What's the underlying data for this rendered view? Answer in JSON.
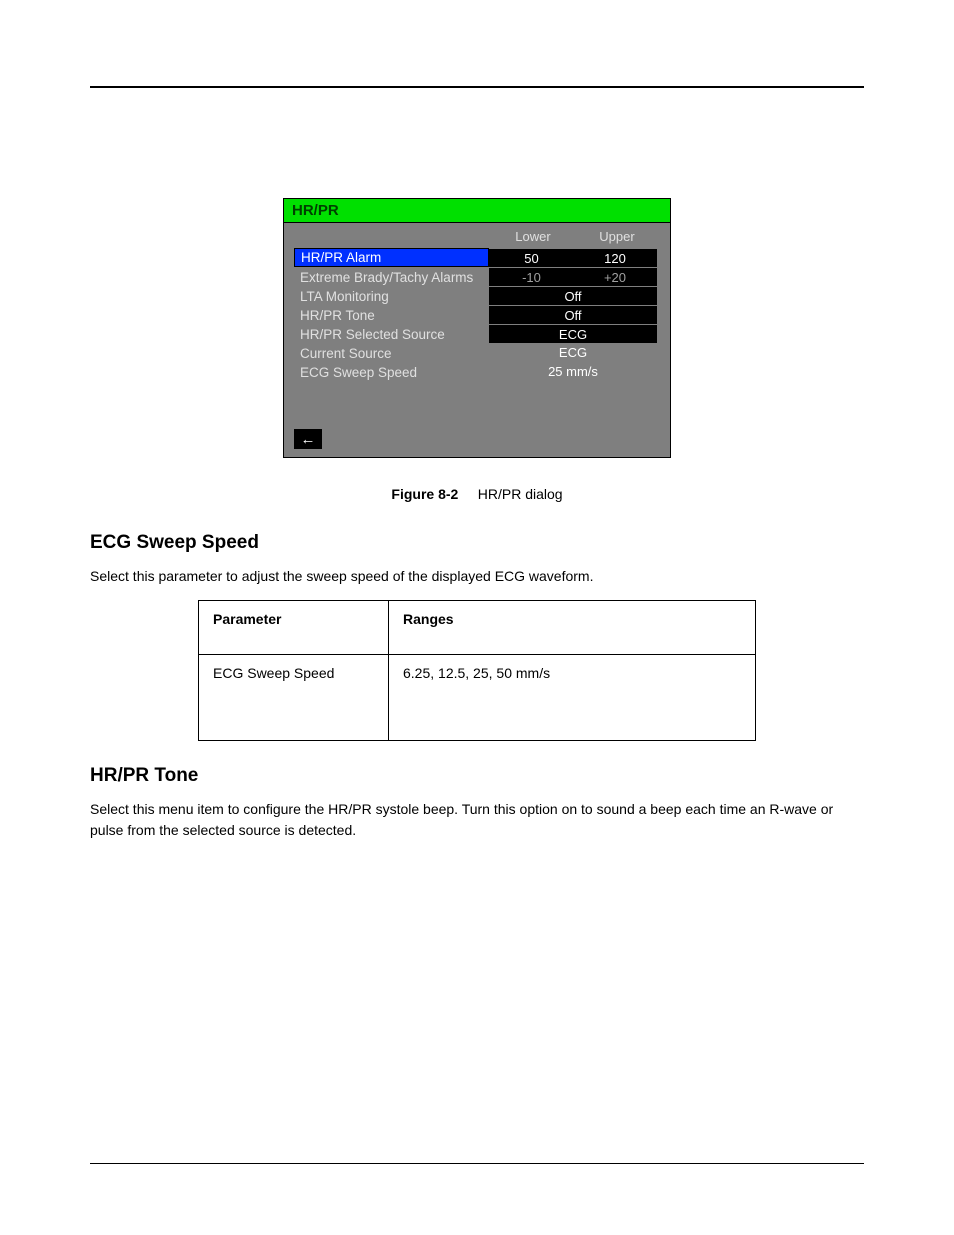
{
  "header": {
    "left": "",
    "right": ""
  },
  "dialog": {
    "title": "HR/PR",
    "col_lower": "Lower",
    "col_upper": "Upper",
    "rows": [
      {
        "label": "HR/PR Alarm",
        "selected": true,
        "lower": "50",
        "upper": "120",
        "split": true
      },
      {
        "label": "Extreme Brady/Tachy Alarms",
        "lower": "-10",
        "upper": "+20",
        "split": true,
        "dimval": true
      },
      {
        "label": "LTA Monitoring",
        "value": "Off"
      },
      {
        "label": "HR/PR Tone",
        "value": "Off"
      },
      {
        "label": "HR/PR Selected Source",
        "value": "ECG"
      },
      {
        "label": "Current Source",
        "value": "ECG",
        "nobox": true
      },
      {
        "label": "ECG Sweep Speed",
        "value": "25 mm/s",
        "nobox": true
      }
    ],
    "back": "←"
  },
  "caption": {
    "num": "Figure 8-2",
    "text": "HR/PR dialog"
  },
  "ecg_sweep": {
    "heading": "ECG Sweep Speed",
    "para": "Select this parameter to adjust the sweep speed of the displayed ECG waveform."
  },
  "param_table": {
    "h1": "Parameter",
    "h2": "Ranges",
    "r1c1": "ECG Sweep Speed",
    "r1c2": "6.25, 12.5, 25, 50 mm/s"
  },
  "hrpr_tone": {
    "heading": "HR/PR Tone",
    "para": "Select this menu item to configure the HR/PR systole beep. Turn this option on to sound a beep each time an R-wave or pulse from the selected source is detected."
  },
  "footer": {
    "left": "",
    "center": "",
    "right": ""
  }
}
